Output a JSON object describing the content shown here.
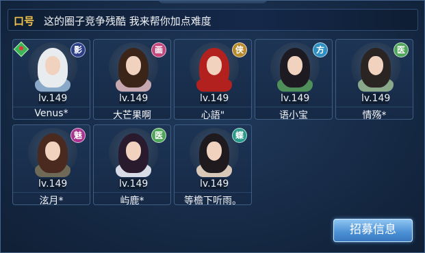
{
  "slogan": {
    "label": "口号",
    "text": "这的圈子竞争残酷 我来帮你加点难度"
  },
  "members": [
    {
      "level": "lv.149",
      "name": "Venus*",
      "class_glyph": "影",
      "class_color": "#2e3f8a",
      "hair_color": "#e8ecef",
      "outfit_color": "#8aa8c8",
      "has_badge": true
    },
    {
      "level": "lv.149",
      "name": "大芒果啊",
      "class_glyph": "画",
      "class_color": "#c2457c",
      "hair_color": "#3b2418",
      "outfit_color": "#c7a8b0",
      "has_badge": false
    },
    {
      "level": "lv.149",
      "name": "心語\"",
      "class_glyph": "侠",
      "class_color": "#b88a2e",
      "hair_color": "#b3211e",
      "outfit_color": "#b3211e",
      "has_badge": false
    },
    {
      "level": "lv.149",
      "name": "语小宝",
      "class_glyph": "方",
      "class_color": "#2d8fc2",
      "hair_color": "#1e1a22",
      "outfit_color": "#4f8f5a",
      "has_badge": false
    },
    {
      "level": "lv.149",
      "name": "情殇*",
      "class_glyph": "医",
      "class_color": "#4fa55a",
      "hair_color": "#2a2422",
      "outfit_color": "#8aa88a",
      "has_badge": false
    },
    {
      "level": "lv.149",
      "name": "泫月*",
      "class_glyph": "魅",
      "class_color": "#a8348f",
      "hair_color": "#4a2a1e",
      "outfit_color": "#6f6a58",
      "has_badge": false
    },
    {
      "level": "lv.149",
      "name": "屿鹿*",
      "class_glyph": "医",
      "class_color": "#4fa55a",
      "hair_color": "#2a1a2e",
      "outfit_color": "#d8dce6",
      "has_badge": false
    },
    {
      "level": "lv.149",
      "name": "等檐下听雨。",
      "class_glyph": "蝶",
      "class_color": "#2a9a8a",
      "hair_color": "#1e1a1e",
      "outfit_color": "#d8c8b8",
      "has_badge": false
    }
  ],
  "recruit_button": "招募信息"
}
